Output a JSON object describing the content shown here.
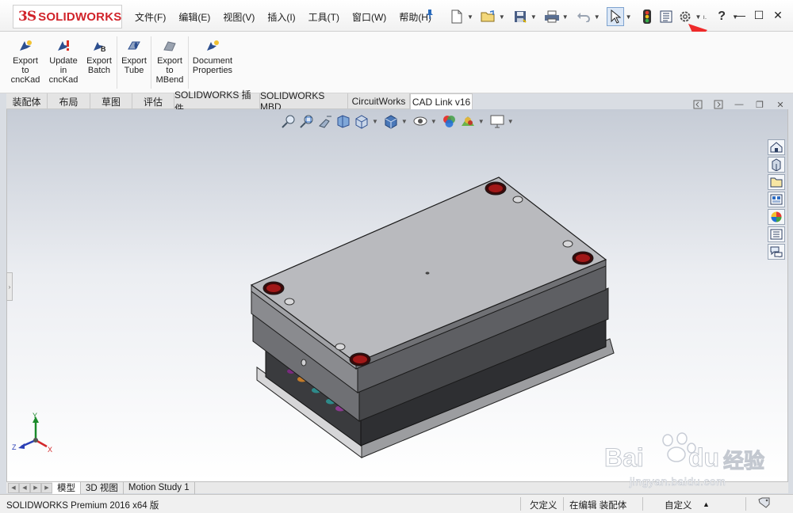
{
  "app": {
    "logo_mark": "3S",
    "logo_text": "SOLIDWORKS",
    "brand_color": "#d1232a"
  },
  "menu": [
    "文件(F)",
    "编辑(E)",
    "视图(V)",
    "插入(I)",
    "工具(T)",
    "窗口(W)",
    "帮助(H)"
  ],
  "quick_tools": [
    {
      "name": "new-document-icon"
    },
    {
      "name": "open-icon"
    },
    {
      "name": "save-icon"
    },
    {
      "name": "print-icon"
    },
    {
      "name": "undo-icon"
    },
    {
      "name": "select-icon"
    },
    {
      "name": "rebuild-icon"
    },
    {
      "name": "file-properties-icon"
    },
    {
      "name": "options-icon"
    },
    {
      "name": "help-icon"
    }
  ],
  "ribbon": {
    "buttons": [
      {
        "label": "Export\nto\ncncKad",
        "icon": "export-cnckad-icon"
      },
      {
        "label": "Update\nin\ncncKad",
        "icon": "update-cnckad-icon"
      },
      {
        "label": "Export\nBatch",
        "icon": "export-batch-icon"
      },
      {
        "label": "Export\nTube",
        "icon": "export-tube-icon"
      },
      {
        "label": "Export\nto\nMBend",
        "icon": "export-mbend-icon"
      },
      {
        "label": "Document\nProperties",
        "icon": "document-properties-icon"
      }
    ]
  },
  "command_tabs": [
    "装配体",
    "布局",
    "草图",
    "评估",
    "SOLIDWORKS 插件",
    "SOLIDWORKS MBD",
    "CircuitWorks",
    "CAD Link v16"
  ],
  "active_tab": "CAD Link v16",
  "task_pane": [
    "home-icon",
    "design-library-icon",
    "file-explorer-icon",
    "view-palette-icon",
    "appearances-icon",
    "custom-properties-icon",
    "forum-icon"
  ],
  "bottom_tabs": [
    "模型",
    "3D 视图",
    "Motion Study 1"
  ],
  "status": {
    "product": "SOLIDWORKS Premium 2016 x64 版",
    "definition": "欠定义",
    "mode": "在编辑 装配体",
    "units": "自定义",
    "units_caret": "▲"
  },
  "triad": {
    "x": "X",
    "y": "Y",
    "z": "Z"
  },
  "watermark": {
    "brand": "Bai",
    "brand2": "du",
    "cn": "经验",
    "url": "jingyan.baidu.com"
  }
}
